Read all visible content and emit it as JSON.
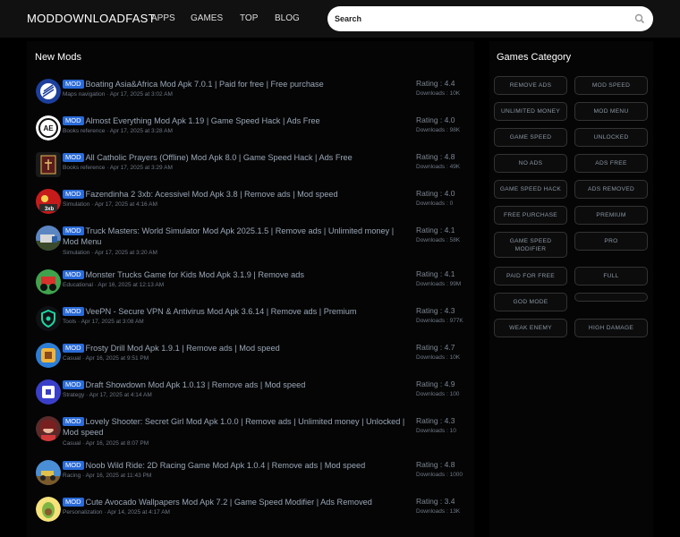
{
  "header": {
    "logo": "MODDOWNLOADFAST",
    "nav": [
      "APPS",
      "GAMES",
      "TOP",
      "BLOG"
    ],
    "search_placeholder": "Search"
  },
  "main": {
    "title": "New Mods",
    "items": [
      {
        "badge": "MOD",
        "title": "Boating Asia&Africa Mod Apk 7.0.1 | Paid for free | Free purchase",
        "meta": "Maps navigation · Apr 17, 2025 at 3:02 AM",
        "rating": "Rating : 4.4",
        "downloads": "Downloads : 10K"
      },
      {
        "badge": "MOD",
        "title": "Almost Everything Mod Apk 1.19 | Game Speed Hack | Ads Free",
        "meta": "Books reference · Apr 17, 2025 at 3:28 AM",
        "rating": "Rating : 4.0",
        "downloads": "Downloads : 98K"
      },
      {
        "badge": "MOD",
        "title": "All Catholic Prayers (Offline) Mod Apk 8.0 | Game Speed Hack | Ads Free",
        "meta": "Books reference · Apr 17, 2025 at 3:29 AM",
        "rating": "Rating : 4.8",
        "downloads": "Downloads : 49K"
      },
      {
        "badge": "MOD",
        "title": "Fazendinha 2 3xb: Acessivel Mod Apk 3.8 | Remove ads | Mod speed",
        "meta": "Simulation · Apr 17, 2025 at 4:16 AM",
        "rating": "Rating : 4.0",
        "downloads": "Downloads : 0"
      },
      {
        "badge": "MOD",
        "title": "Truck Masters: World Simulator Mod Apk 2025.1.5 | Remove ads | Unlimited money | Mod Menu",
        "meta": "Simulation · Apr 17, 2025 at 3:20 AM",
        "rating": "Rating : 4.1",
        "downloads": "Downloads : 58K"
      },
      {
        "badge": "MOD",
        "title": "Monster Trucks Game for Kids Mod Apk 3.1.9 | Remove ads",
        "meta": "Educational · Apr 16, 2025 at 12:13 AM",
        "rating": "Rating : 4.1",
        "downloads": "Downloads : 99M"
      },
      {
        "badge": "MOD",
        "title": "VeePN - Secure VPN & Antivirus Mod Apk 3.6.14 | Remove ads | Premium",
        "meta": "Tools · Apr 17, 2025 at 3:08 AM",
        "rating": "Rating : 4.3",
        "downloads": "Downloads : 977K"
      },
      {
        "badge": "MOD",
        "title": "Frosty Drill Mod Apk 1.9.1 | Remove ads | Mod speed",
        "meta": "Casual · Apr 16, 2025 at 9:51 PM",
        "rating": "Rating : 4.7",
        "downloads": "Downloads : 10K"
      },
      {
        "badge": "MOD",
        "title": "Draft Showdown Mod Apk 1.0.13 | Remove ads | Mod speed",
        "meta": "Strategy · Apr 17, 2025 at 4:14 AM",
        "rating": "Rating : 4.9",
        "downloads": "Downloads : 100"
      },
      {
        "badge": "MOD",
        "title": "Lovely Shooter: Secret Girl Mod Apk 1.0.0 | Remove ads | Unlimited money | Unlocked | Mod speed",
        "meta": "Casual · Apr 16, 2025 at 8:07 PM",
        "rating": "Rating : 4.3",
        "downloads": "Downloads : 10"
      },
      {
        "badge": "MOD",
        "title": "Noob Wild Ride: 2D Racing Game Mod Apk 1.0.4 | Remove ads | Mod speed",
        "meta": "Racing · Apr 16, 2025 at 11:43 PM",
        "rating": "Rating : 4.8",
        "downloads": "Downloads : 1000"
      },
      {
        "badge": "MOD",
        "title": "Cute Avocado Wallpapers Mod Apk 7.2 | Game Speed Modifier | Ads Removed",
        "meta": "Personalization · Apr 14, 2025 at 4:17 AM",
        "rating": "Rating : 3.4",
        "downloads": "Downloads : 13K"
      }
    ]
  },
  "sidebar": {
    "title": "Games Category",
    "categories": [
      "REMOVE ADS",
      "MOD SPEED",
      "UNLIMITED MONEY",
      "MOD MENU",
      "GAME SPEED",
      "UNLOCKED",
      "NO ADS",
      "ADS FREE",
      "GAME SPEED HACK",
      "ADS REMOVED",
      "FREE PURCHASE",
      "PREMIUM",
      "GAME SPEED MODIFIER",
      "PRO",
      "PAID FOR FREE",
      "FULL",
      "GOD MODE",
      "",
      "WEAK ENEMY",
      "HIGH DAMAGE"
    ]
  }
}
